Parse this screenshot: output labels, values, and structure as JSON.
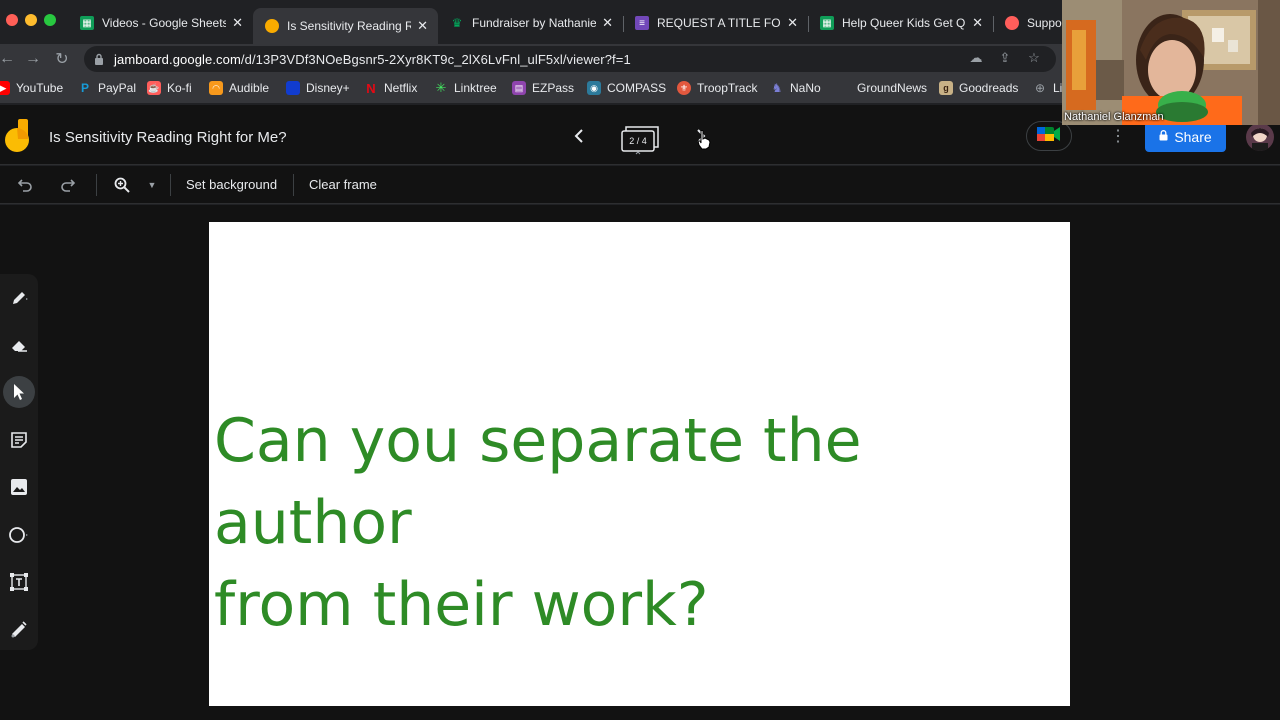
{
  "browser": {
    "tabs": [
      {
        "title": "Videos - Google Sheets",
        "icon": "sheets-icon",
        "color": "#0f9d58",
        "active": false
      },
      {
        "title": "Is Sensitivity Reading Ri",
        "icon": "jamboard-icon",
        "color": "#f9ab00",
        "active": true
      },
      {
        "title": "Fundraiser by Nathaniel",
        "icon": "gofundme-icon",
        "color": "#02a95c",
        "active": false
      },
      {
        "title": "REQUEST A TITLE FOR",
        "icon": "forms-icon",
        "color": "#7248b9",
        "active": false
      },
      {
        "title": "Help Queer Kids Get Qu",
        "icon": "sheets-icon",
        "color": "#0f9d58",
        "active": false
      },
      {
        "title": "Suppor",
        "icon": "kofi-icon",
        "color": "#ff5e5b",
        "active": false
      }
    ],
    "close_glyph": "✕",
    "url_host": "jamboard.google.com",
    "url_path": "/d/13P3VDf3NOeBgsnr5-2Xyr8KT9c_2lX6LvFnl_ulF5xl/viewer?f=1",
    "bookmarks": [
      {
        "label": "YouTube",
        "icon": "youtube-icon",
        "color": "#ff0000"
      },
      {
        "label": "PayPal",
        "icon": "paypal-icon",
        "color": "#179bd7"
      },
      {
        "label": "Ko-fi",
        "icon": "kofi-icon",
        "color": "#ff5e5b"
      },
      {
        "label": "Audible",
        "icon": "audible-icon",
        "color": "#f7991c"
      },
      {
        "label": "Disney+",
        "icon": "disney-icon",
        "color": "#113ccf"
      },
      {
        "label": "Netflix",
        "icon": "netflix-icon",
        "color": "#e50914"
      },
      {
        "label": "Linktree",
        "icon": "linktree-icon",
        "color": "#43e660"
      },
      {
        "label": "EZPass",
        "icon": "ezpass-icon",
        "color": "#8e44ad"
      },
      {
        "label": "COMPASS",
        "icon": "compass-icon",
        "color": "#2c7a9b"
      },
      {
        "label": "TroopTrack",
        "icon": "trooptrack-icon",
        "color": "#e2583e"
      },
      {
        "label": "NaNo",
        "icon": "nano-icon",
        "color": "#7b7fd6"
      },
      {
        "label": "GroundNews",
        "icon": "groundnews-icon",
        "color": "#333333"
      },
      {
        "label": "Goodreads",
        "icon": "goodreads-icon",
        "color": "#c8b186"
      },
      {
        "label": "Li",
        "icon": "globe-icon",
        "color": "#9aa0a6"
      }
    ]
  },
  "jamboard": {
    "title": "Is Sensitivity Reading Right for Me?",
    "frame_counter": "2 / 4",
    "share_label": "Share",
    "toolbar": {
      "set_background": "Set background",
      "clear_frame": "Clear frame"
    },
    "frame": {
      "line1": "Can you separate the author",
      "line2": "from their work?",
      "text_color": "#2e8b26"
    },
    "tools": [
      "pen-icon",
      "eraser-icon",
      "select-icon",
      "sticky-note-icon",
      "image-icon",
      "circle-icon",
      "text-box-icon",
      "laser-icon"
    ],
    "active_tool": "select-icon"
  },
  "webcam": {
    "participant_name": "Nathaniel Glanzman"
  }
}
